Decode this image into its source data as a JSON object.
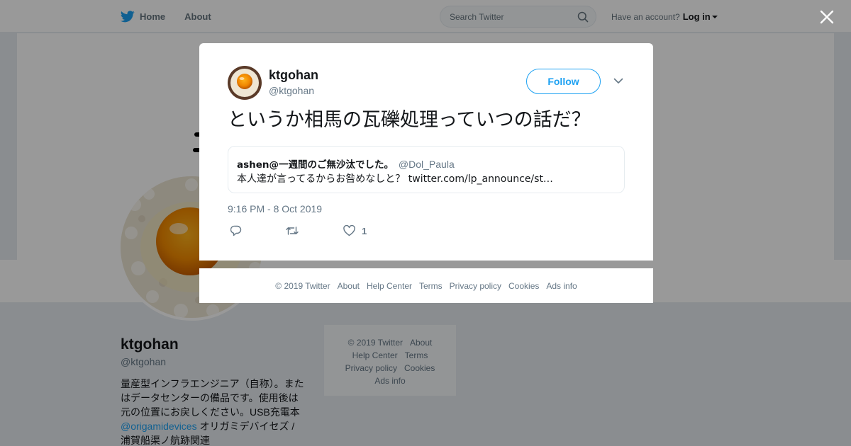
{
  "topbar": {
    "home_label": "Home",
    "about_label": "About",
    "search_placeholder": "Search Twitter",
    "have_account": "Have an account?",
    "login_label": "Log in"
  },
  "profile": {
    "name": "ktgohan",
    "handle": "@ktgohan",
    "bio_part1": "量産型インフラエンジニア（自称）。またはデータセンターの備品です。使用後は元の位置にお戻しください。USB充電本 ",
    "bio_link": "@origamidevices",
    "bio_part2": " オリガミデバイセズ / 浦賀船渠ノ航跡関連"
  },
  "side_footer": {
    "row1": [
      "© 2019 Twitter",
      "About"
    ],
    "row2": [
      "Help Center",
      "Terms"
    ],
    "row3": [
      "Privacy policy",
      "Cookies"
    ],
    "row4": [
      "Ads info"
    ]
  },
  "tweet": {
    "author_name": "ktgohan",
    "author_handle": "@ktgohan",
    "follow_label": "Follow",
    "text": "というか相馬の瓦礫処理っていつの話だ？",
    "quote": {
      "name": "ashen@一週間のご無沙汰でした。",
      "handle": "@Dol_Paula",
      "text": "本人達が言ってるからお咎めなしと？ twitter.com/lp_announce/st…"
    },
    "timestamp": "9:16 PM - 8 Oct 2019",
    "like_count": "1"
  },
  "modal_footer": {
    "links": [
      "© 2019 Twitter",
      "About",
      "Help Center",
      "Terms",
      "Privacy policy",
      "Cookies",
      "Ads info"
    ]
  },
  "icons": {
    "brand": "twitter-bird-icon",
    "search": "search-icon",
    "close": "close-icon",
    "more": "chevron-down-icon",
    "reply": "reply-icon",
    "retweet": "retweet-icon",
    "like": "heart-icon"
  },
  "colors": {
    "brand_blue": "#1da1f2",
    "text_primary": "#14171a",
    "text_secondary": "#657786",
    "overlay": "rgba(0,0,0,0.40)"
  }
}
